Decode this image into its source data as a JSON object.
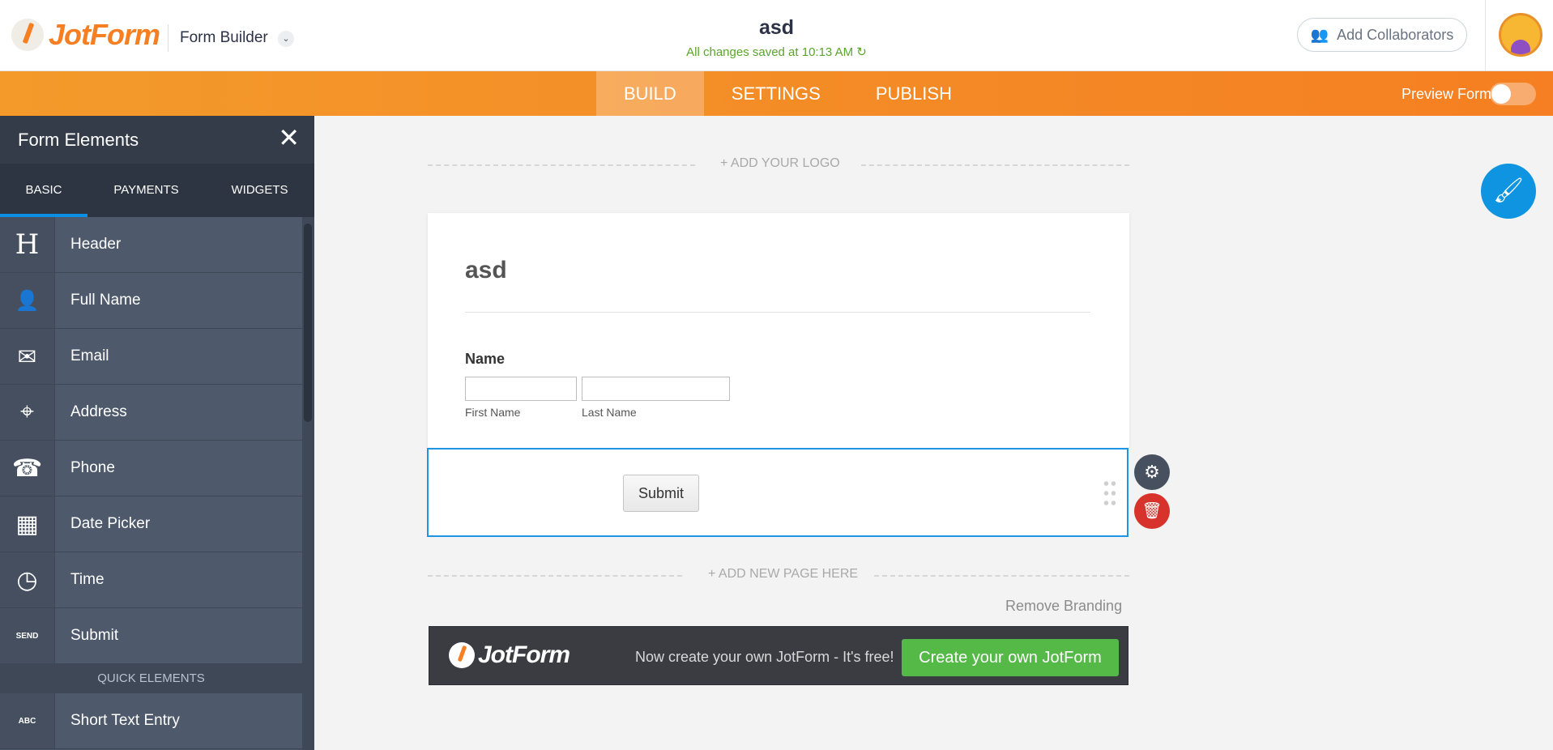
{
  "header": {
    "logo_text": "JotForm",
    "builder_label": "Form Builder",
    "builder_caret": "⌄",
    "form_title": "asd",
    "save_status": "All changes saved at 10:13 AM",
    "refresh_icon": "↻",
    "collab_icon": "👥",
    "collab_label": "Add Collaborators"
  },
  "nav": {
    "tabs": [
      "BUILD",
      "SETTINGS",
      "PUBLISH"
    ],
    "active_tab": "BUILD",
    "preview_label": "Preview Form",
    "preview_on": false
  },
  "panel": {
    "title": "Form Elements",
    "close_icon": "✕",
    "tabs": [
      "BASIC",
      "PAYMENTS",
      "WIDGETS"
    ],
    "active_tab": "BASIC",
    "elements": [
      {
        "label": "Header",
        "icon": "H"
      },
      {
        "label": "Full Name",
        "icon": "👤"
      },
      {
        "label": "Email",
        "icon": "✉"
      },
      {
        "label": "Address",
        "icon": "⌖"
      },
      {
        "label": "Phone",
        "icon": "☎"
      },
      {
        "label": "Date Picker",
        "icon": "▦"
      },
      {
        "label": "Time",
        "icon": "◷"
      },
      {
        "label": "Submit",
        "icon": "SEND"
      }
    ],
    "quick_header": "QUICK ELEMENTS",
    "quick_elements": [
      {
        "label": "Short Text Entry",
        "icon": "ABC"
      }
    ]
  },
  "canvas": {
    "add_logo": "+ ADD YOUR LOGO",
    "form_heading": "asd",
    "name_label": "Name",
    "first_name_sublabel": "First Name",
    "last_name_sublabel": "Last Name",
    "submit_label": "Submit",
    "gear_icon": "⚙",
    "trash_icon": "🗑",
    "add_page": "+ ADD NEW PAGE HERE",
    "remove_branding": "Remove Branding",
    "brand_name": "JotForm",
    "brand_tagline": "Now create your own JotForm - It's free!",
    "brand_cta": "Create your own JotForm",
    "fab_icon": "🖌"
  },
  "colors": {
    "brand_orange": "#f57f22",
    "panel_dark": "#343c4a",
    "selection_blue": "#1e94e3",
    "cta_green": "#55b948",
    "delete_red": "#d7322b"
  }
}
